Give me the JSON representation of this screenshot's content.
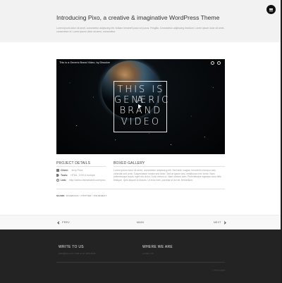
{
  "header": {
    "title": "Introducing Pixo, a creative & imaginative WordPress Theme",
    "subtitle": "Lorem ipsum dolor sit amet, consectetur adipiscing elit. Nullam hendrerit justo vel purus. Fringilla. Consectetur adipiscing tincidunt. Lorem ipsum dolor sit amet, consectetur et. Lorem ipsum dolor sit amet, consectetur."
  },
  "video": {
    "title": "This is a Generic Brand Video, by Dissolve",
    "brand_lines": [
      "THIS IS A",
      "GENERIC",
      "BRAND",
      "VIDEO"
    ]
  },
  "project_details": {
    "heading": "PROJECT DETAILS",
    "rows": [
      {
        "icon": "calendar-icon",
        "label": "Client:",
        "value": "Jerry Price"
      },
      {
        "icon": "tag-icon",
        "label": "Tools:",
        "value": "HTML, CSS & Isotope"
      },
      {
        "icon": "link-icon",
        "label": "Link:",
        "value": "http://demo.themeearth.com/pixo"
      }
    ]
  },
  "boxed_gallery": {
    "heading": "BOXED GALLERY",
    "text": "Lorem ipsum dolor sit amet, consectetur adipiscing elit. Sed ante magna, hendrerit a tempor sed, vehicula sed urna. Suspendisse ornare sed dolor. Sed at ipsum sed, vestibulum nec tortor. Nam pellentesque turpis, eget nec dolor. Duis viverra ut. Nam ultrices sem, Pellentesque egestas risus felis tristique. Quis aliquet ut mauris. Ut eros nibh, pulvinar ut dui sit, fermentum."
  },
  "share": {
    "label": "SHARE:",
    "links": "FACEBOOK  /  TWITTER  /  PINTEREST"
  },
  "pager": {
    "prev": "PREV",
    "main": "MAIN",
    "next": "NEXT"
  },
  "footer": {
    "write_heading": "WRITE TO US",
    "write_text": "hello@pixo.com / Call us on 1234 5678",
    "where_heading": "WHERE WE ARE",
    "where_text": "London, UK",
    "copyright": "© PIXO 2015"
  }
}
